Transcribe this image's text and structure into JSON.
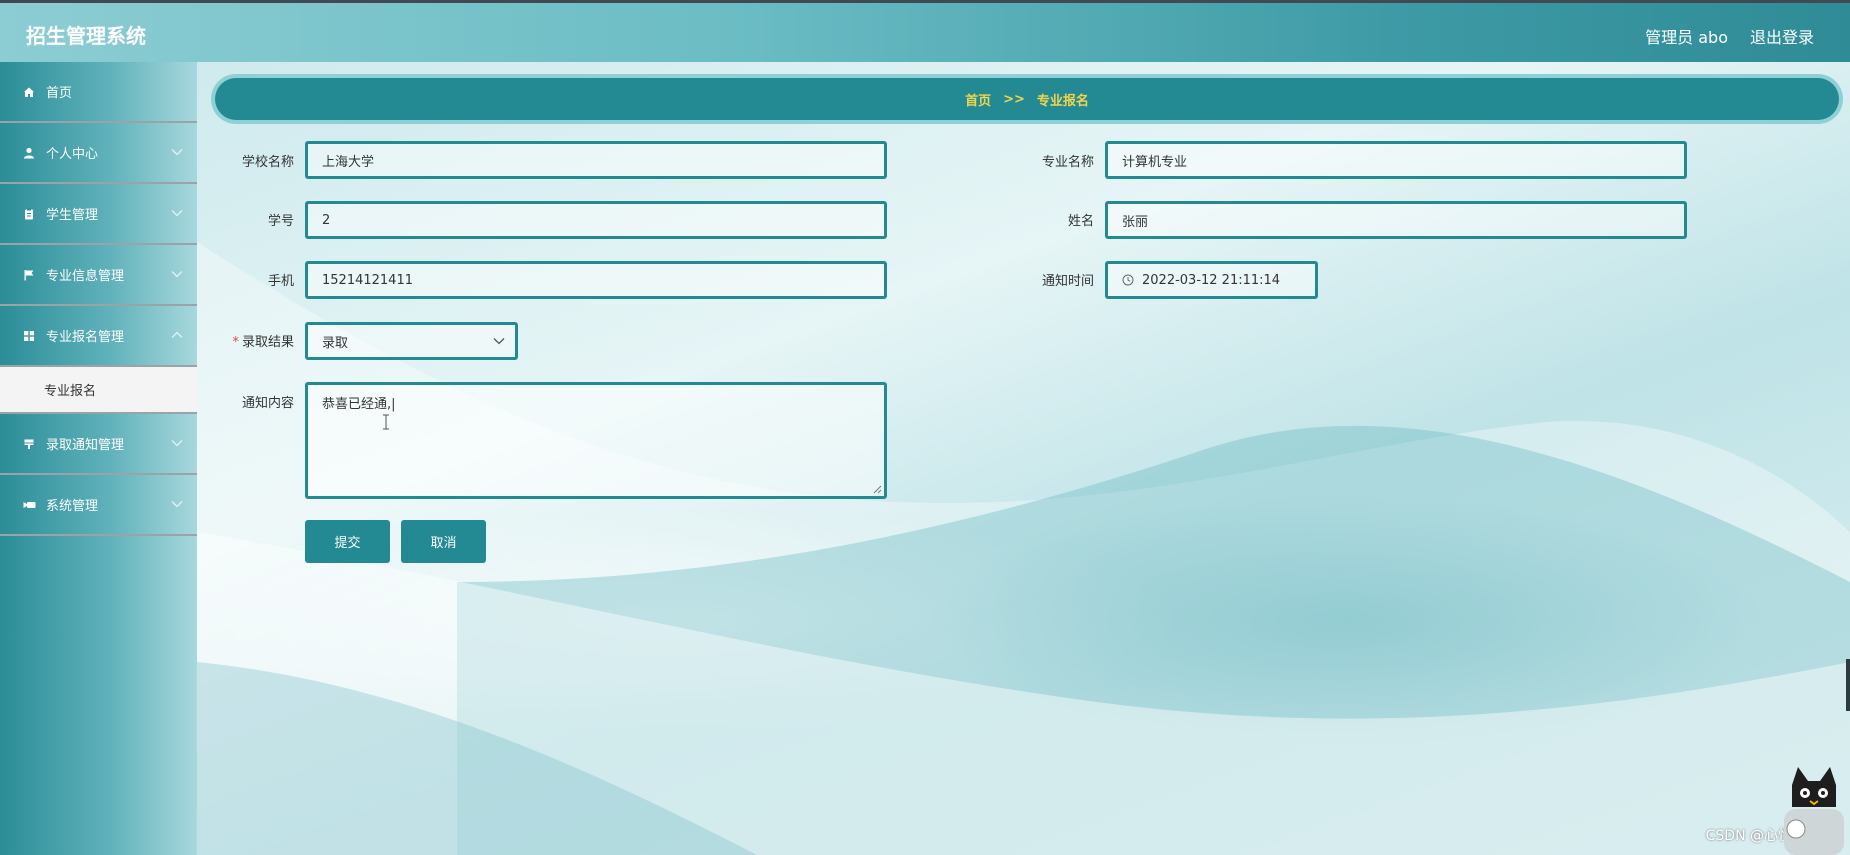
{
  "header": {
    "title": "招生管理系统",
    "user": "管理员 abo",
    "logout": "退出登录"
  },
  "sidebar": {
    "items": [
      {
        "label": "首页",
        "icon": "home-icon"
      },
      {
        "label": "个人中心",
        "icon": "person-icon"
      },
      {
        "label": "学生管理",
        "icon": "clipboard-icon"
      },
      {
        "label": "专业信息管理",
        "icon": "flag-icon"
      },
      {
        "label": "专业报名管理",
        "icon": "grid-icon"
      },
      {
        "label": "录取通知管理",
        "icon": "stamp-icon"
      },
      {
        "label": "系统管理",
        "icon": "camera-icon"
      }
    ],
    "active_sub": "专业报名"
  },
  "breadcrumb": {
    "home": "首页",
    "separator": ">>",
    "current": "专业报名"
  },
  "form": {
    "school_label": "学校名称",
    "school_value": "上海大学",
    "major_label": "专业名称",
    "major_value": "计算机专业",
    "student_no_label": "学号",
    "student_no_value": "2",
    "name_label": "姓名",
    "name_value": "张丽",
    "phone_label": "手机",
    "phone_value": "15214121411",
    "notice_time_label": "通知时间",
    "notice_time_value": "2022-03-12 21:11:14",
    "result_label": "录取结果",
    "result_required_mark": "*",
    "result_value": "录取",
    "content_label": "通知内容",
    "content_value": "恭喜已经通,|"
  },
  "buttons": {
    "submit": "提交",
    "cancel": "取消"
  },
  "watermark": "CSDN @心悦毕设",
  "colors": {
    "accent": "#238a93",
    "breadcrumb_text": "#f1d54a",
    "required": "#e04545"
  }
}
